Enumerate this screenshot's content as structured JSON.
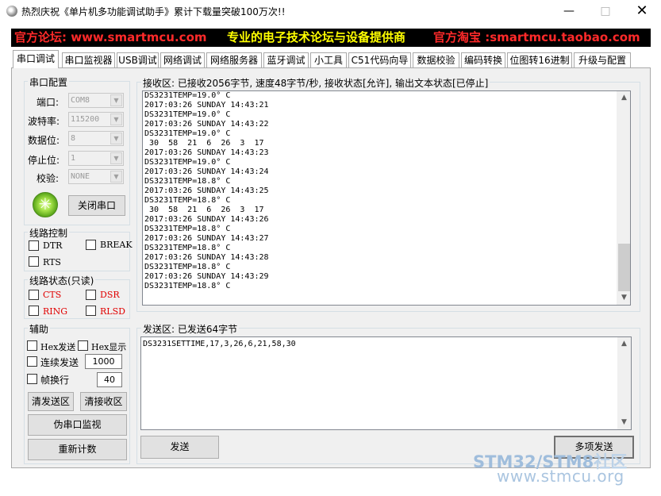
{
  "window": {
    "title": "热烈庆祝《单片机多功能调试助手》累计下载量突破100万次!!",
    "minimize": "—",
    "maximize": "□",
    "close": "✕"
  },
  "banner": {
    "left": "官方论坛: www.smartmcu.com",
    "middle": "专业的电子技术论坛与设备提供商",
    "right": "官方淘宝 :smartmcu.taobao.com"
  },
  "tabs": [
    "串口调试",
    "串口监视器",
    "USB调试",
    "网络调试",
    "网络服务器",
    "蓝牙调试",
    "小工具",
    "C51代码向导",
    "数据校验",
    "编码转换",
    "位图转16进制",
    "升级与配置"
  ],
  "serial_config": {
    "title": "串口配置",
    "port_label": "端口:",
    "port_value": "COM8",
    "baud_label": "波特率:",
    "baud_value": "115200",
    "databits_label": "数据位:",
    "databits_value": "8",
    "stopbits_label": "停止位:",
    "stopbits_value": "1",
    "parity_label": "校验:",
    "parity_value": "NONE",
    "close_button": "关闭串口"
  },
  "line_control": {
    "title": "线路控制",
    "dtr": "DTR",
    "break": "BREAK",
    "rts": "RTS"
  },
  "line_status": {
    "title": "线路状态(只读)",
    "cts": "CTS",
    "dsr": "DSR",
    "ring": "RING",
    "rlsd": "RLSD"
  },
  "aux": {
    "title": "辅助",
    "hex_send": "Hex发送",
    "hex_display": "Hex显示",
    "continuous_send": "连续发送",
    "continuous_value": "1000",
    "frame_wrap": "帧换行",
    "frame_value": "40",
    "clear_send": "清发送区",
    "clear_recv": "清接收区",
    "pseudo_monitor": "伪串口监视",
    "recount": "重新计数"
  },
  "receive": {
    "title": "接收区: 已接收2056字节, 速度48字节/秒, 接收状态[允许], 输出文本状态[已停止]",
    "lines": [
      "DS3231TEMP=19.0° C",
      "2017:03:26 SUNDAY 14:43:21",
      "DS3231TEMP=19.0° C",
      "2017:03:26 SUNDAY 14:43:22",
      "DS3231TEMP=19.0° C",
      " 30  58  21  6  26  3  17",
      "2017:03:26 SUNDAY 14:43:23",
      "DS3231TEMP=19.0° C",
      "2017:03:26 SUNDAY 14:43:24",
      "DS3231TEMP=18.8° C",
      "2017:03:26 SUNDAY 14:43:25",
      "DS3231TEMP=18.8° C",
      " 30  58  21  6  26  3  17",
      "2017:03:26 SUNDAY 14:43:26",
      "DS3231TEMP=18.8° C",
      "2017:03:26 SUNDAY 14:43:27",
      "DS3231TEMP=18.8° C",
      "2017:03:26 SUNDAY 14:43:28",
      "DS3231TEMP=18.8° C",
      "2017:03:26 SUNDAY 14:43:29",
      "DS3231TEMP=18.8° C"
    ]
  },
  "send": {
    "title": "发送区: 已发送64字节",
    "text": "DS3231SETTIME,17,3,26,6,21,58,30",
    "send_button": "发送",
    "multi_send_button": "多项发送"
  },
  "watermark": {
    "stm32": "STM32",
    "slash": "/",
    "stm8": "STM8",
    "community": "社区",
    "url": "www.stmcu.org"
  },
  "icons": {
    "app": "app-icon",
    "led": "led-indicator-icon"
  },
  "colors": {
    "banner_red": "#ff2a2a",
    "banner_yellow": "#ffff00",
    "status_red": "#e00000",
    "led_green": "#5aa61a"
  }
}
